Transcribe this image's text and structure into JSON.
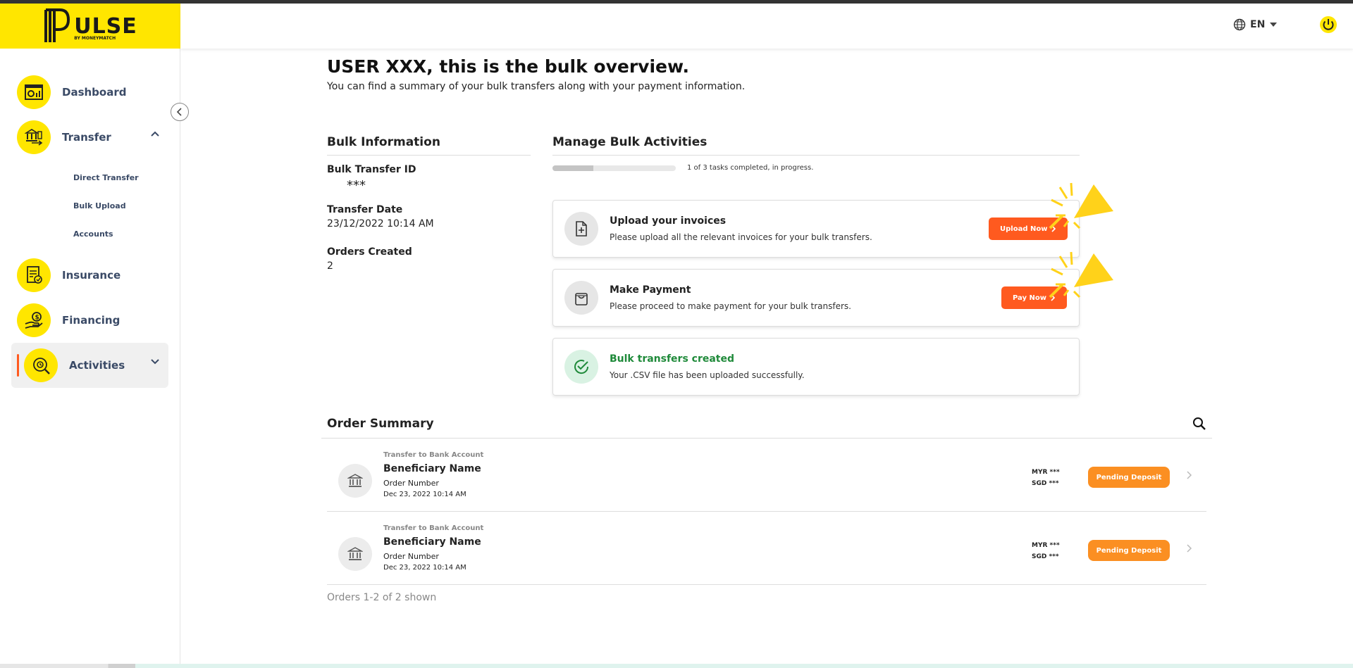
{
  "brand": {
    "logo_text": "ULSE",
    "logo_sub": "BY MONEYMATCH"
  },
  "header": {
    "language": "EN"
  },
  "sidebar": {
    "items": [
      {
        "label": "Dashboard",
        "icon": "dashboard-icon"
      },
      {
        "label": "Transfer",
        "icon": "bank-transfer-icon",
        "expanded": true
      },
      {
        "label": "Insurance",
        "icon": "insurance-document-icon"
      },
      {
        "label": "Financing",
        "icon": "financing-hand-icon"
      },
      {
        "label": "Activities",
        "icon": "activities-search-icon",
        "active": true
      }
    ],
    "transfer_subitems": [
      "Direct Transfer",
      "Bulk Upload",
      "Accounts"
    ]
  },
  "page": {
    "title": "USER XXX, this is the bulk overview.",
    "subtitle": "You can find a summary of your bulk transfers along with your payment information."
  },
  "bulk_info": {
    "title": "Bulk Information",
    "id_label": "Bulk Transfer ID",
    "id_value": "***",
    "date_label": "Transfer Date",
    "date_value": "23/12/2022 10:14 AM",
    "orders_label": "Orders Created",
    "orders_value": "2"
  },
  "manage": {
    "title": "Manage Bulk Activities",
    "progress_fraction": 0.333,
    "progress_text": "1 of 3 tasks completed, in progress.",
    "tasks": [
      {
        "title": "Upload your invoices",
        "desc": "Please upload all the relevant invoices for your bulk transfers.",
        "button": "Upload Now"
      },
      {
        "title": "Make Payment",
        "desc": "Please proceed to make payment for your bulk transfers.",
        "button": "Pay Now"
      },
      {
        "title": "Bulk transfers created",
        "desc": "Your .CSV file has been uploaded successfully."
      }
    ]
  },
  "orders": {
    "title": "Order Summary",
    "rows": [
      {
        "type": "Transfer to Bank Account",
        "name": "Beneficiary Name",
        "number": "Order Number",
        "date": "Dec 23, 2022 10:14 AM",
        "amount1": "MYR ***",
        "amount2": "SGD ***",
        "status": "Pending Deposit"
      },
      {
        "type": "Transfer to Bank Account",
        "name": "Beneficiary Name",
        "number": "Order Number",
        "date": "Dec 23, 2022 10:14 AM",
        "amount1": "MYR ***",
        "amount2": "SGD ***",
        "status": "Pending Deposit"
      }
    ],
    "shown_text": "Orders 1-2 of 2 shown"
  },
  "colors": {
    "brand_yellow": "#ffe600",
    "accent_orange": "#ff5a1f",
    "pending_orange": "#fb8f22",
    "success_green": "#1f8a3a"
  }
}
